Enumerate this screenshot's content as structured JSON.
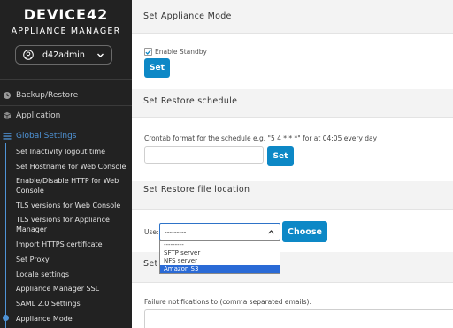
{
  "brand": {
    "logo_main": "DEVICE",
    "logo_num": "42",
    "subtitle": "APPLIANCE MANAGER"
  },
  "user": {
    "name": "d42admin"
  },
  "nav": {
    "backup": "Backup/Restore",
    "application": "Application",
    "global_settings": "Global Settings",
    "items": [
      "Set Inactivity logout time",
      "Set Hostname for Web Console",
      "Enable/Disable HTTP for Web Console",
      "TLS versions for Web Console",
      "TLS versions for Appliance Manager",
      "Import HTTPS certificate",
      "Set Proxy",
      "Locale settings",
      "Appliance Manager SSL",
      "SAML 2.0 Settings",
      "Appliance Mode"
    ]
  },
  "main": {
    "appliance_mode": {
      "title": "Set Appliance Mode",
      "checkbox_label": "Enable Standby",
      "set_label": "Set"
    },
    "restore_schedule": {
      "title": "Set Restore schedule",
      "crontab_text": "Crontab format for the schedule e.g. \"5 4 * * *\" for at 04:05 every day",
      "set_label": "Set"
    },
    "restore_location": {
      "title": "Set Restore file location",
      "use_label": "Use:",
      "selected": "---------",
      "options": [
        "---------",
        "SFTP server",
        "NFS server",
        "Amazon S3"
      ],
      "choose_label": "Choose"
    },
    "notifications": {
      "title_partial": "Set",
      "failure_label": "Failure notifications to (comma separated emails):"
    }
  },
  "colors": {
    "sidebar_bg": "#222222",
    "accent": "#0d88c6",
    "nav_active": "#4f93d6",
    "dropdown_highlight": "#2a6ad6"
  }
}
